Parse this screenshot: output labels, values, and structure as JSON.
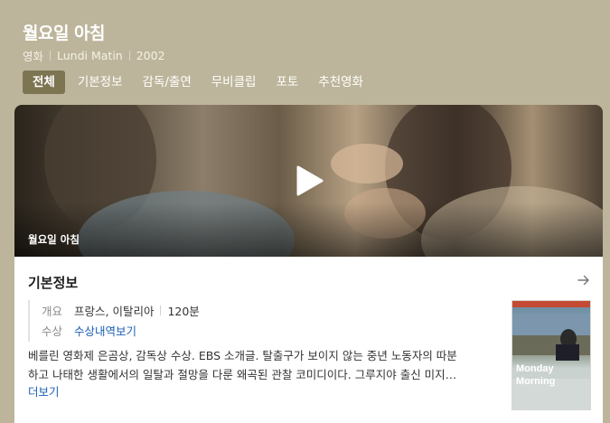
{
  "movie": {
    "title": "월요일 아침",
    "type": "영화",
    "original_title": "Lundi Matin",
    "year": "2002"
  },
  "tabs": [
    {
      "label": "전체",
      "active": true
    },
    {
      "label": "기본정보",
      "active": false
    },
    {
      "label": "감독/출연",
      "active": false
    },
    {
      "label": "무비클립",
      "active": false
    },
    {
      "label": "포토",
      "active": false
    },
    {
      "label": "추천영화",
      "active": false
    }
  ],
  "video": {
    "caption": "월요일 아침",
    "icon": "play-icon"
  },
  "basic_info": {
    "section_title": "기본정보",
    "arrow_icon": "arrow-right-icon",
    "overview_label": "개요",
    "country": "프랑스, 이탈리아",
    "runtime": "120분",
    "award_label": "수상",
    "award_link": "수상내역보기",
    "description_line1": "베를린 영화제 은곰상, 감독상 수상. EBS 소개글. 탈출구가 보이지 않는 중년 노동자의 따분",
    "description_line2": "하고 나태한 생활에서의 일탈과 절망을 다룬 왜곡된 관찰 코미디이다. 그루지야 출신 미지…",
    "more_label": "더보기"
  },
  "poster": {
    "title_line1": "Monday",
    "title_line2": "Morning"
  },
  "colors": {
    "header_bg": "#bdb59b",
    "active_tab_bg": "#7d7452",
    "link": "#1a5fb4"
  }
}
